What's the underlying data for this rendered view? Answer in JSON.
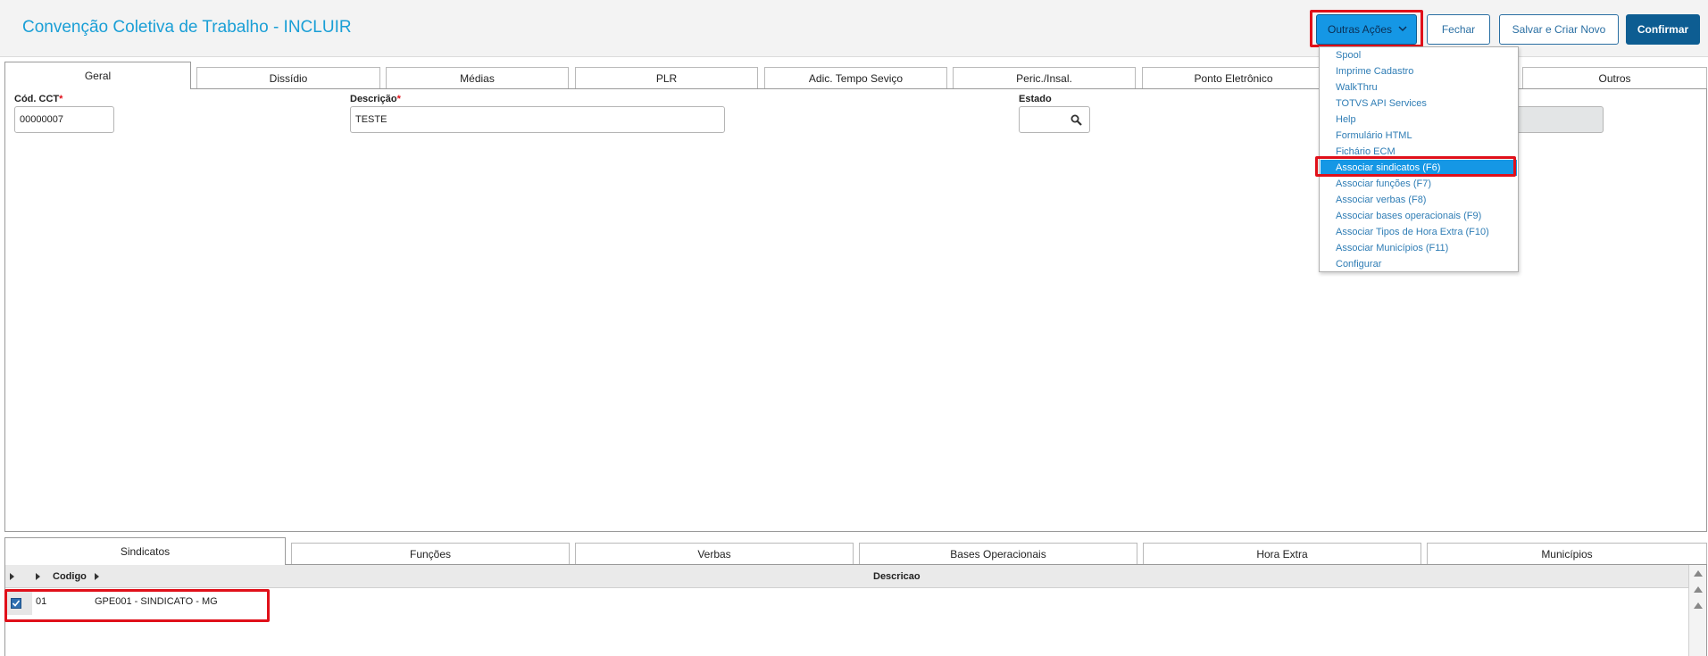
{
  "header": {
    "title": "Convenção Coletiva de Trabalho - INCLUIR",
    "actions_label": "Outras Ações",
    "close_label": "Fechar",
    "save_new_label": "Salvar e Criar Novo",
    "confirm_label": "Confirmar"
  },
  "top_tabs": [
    "Geral",
    "Dissídio",
    "Médias",
    "PLR",
    "Adic. Tempo Seviço",
    "Peric./Insal.",
    "Ponto Eletrônico",
    "Outros"
  ],
  "form": {
    "cod_label": "Cód. CCT",
    "cod_value": "00000007",
    "desc_label": "Descrição",
    "desc_value": "TESTE",
    "estado_label": "Estado",
    "estado_value": "",
    "required_mark": "*"
  },
  "menu": {
    "items": [
      "Spool",
      "Imprime Cadastro",
      "WalkThru",
      "TOTVS API Services",
      "Help",
      "Formulário HTML",
      "Fichário ECM",
      "Associar sindicatos (F6)",
      "Associar funções (F7)",
      "Associar verbas (F8)",
      "Associar bases operacionais (F9)",
      "Associar Tipos de Hora Extra (F10)",
      "Associar Municípios (F11)",
      "Configurar"
    ],
    "selected_index": 7
  },
  "bottom_tabs": [
    "Sindicatos",
    "Funções",
    "Verbas",
    "Bases Operacionais",
    "Hora Extra",
    "Municípios"
  ],
  "grid": {
    "columns": [
      "Codigo",
      "Descricao"
    ],
    "rows": [
      {
        "checked": true,
        "code": "01",
        "description": "GPE001 - SINDICATO - MG"
      }
    ]
  },
  "colors": {
    "title": "#1a9fd6",
    "accent": "#1597e5",
    "primary": "#0d5d92",
    "highlight": "#e0101a"
  },
  "icons": [
    "search-icon",
    "chevron-down-icon",
    "checkbox-icon",
    "scroll-up-icon"
  ]
}
